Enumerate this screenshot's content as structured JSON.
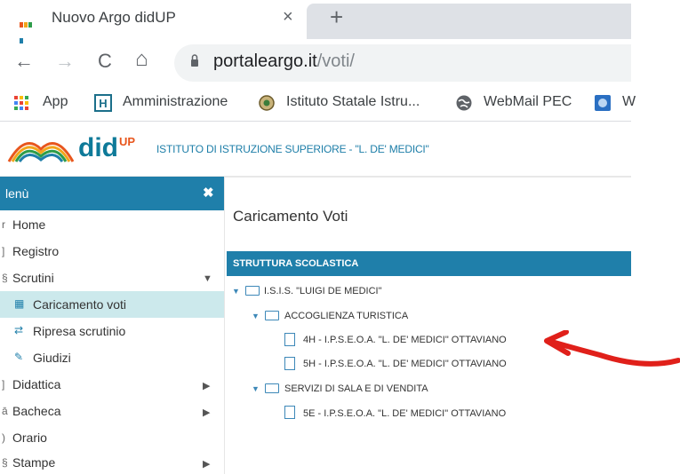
{
  "browser": {
    "tab_title": "Nuovo Argo didUP",
    "tab_close": "×",
    "new_tab": "+",
    "back": "←",
    "forward": "→",
    "reload": "C",
    "home": "⌂",
    "url_host": "portaleargo.it",
    "url_path": "/voti/",
    "bookmarks": [
      "App",
      "Amministrazione",
      "Istituto Statale Istru...",
      "WebMail PEC",
      "W"
    ]
  },
  "app": {
    "logo_text": "did",
    "logo_sup": "UP",
    "school_name": "ISTITUTO DI ISTRUZIONE SUPERIORE - \"L. DE' MEDICI\""
  },
  "sidebar": {
    "title": "lenù",
    "close": "✖",
    "items": [
      {
        "label": "Home",
        "icon": "home-icon",
        "glyph": "r"
      },
      {
        "label": "Registro",
        "icon": "register-icon",
        "glyph": "]"
      },
      {
        "label": "Scrutini",
        "icon": "scrutini-icon",
        "glyph": "§",
        "caret": "▼"
      },
      {
        "label": "Caricamento voti",
        "icon": "grid-icon",
        "glyph": "▦",
        "active": true
      },
      {
        "label": "Ripresa scrutinio",
        "icon": "refresh-icon",
        "glyph": "⇄"
      },
      {
        "label": "Giudizi",
        "icon": "edit-icon",
        "glyph": "✎"
      },
      {
        "label": "Didattica",
        "icon": "didattica-icon",
        "glyph": "]",
        "caret": "▶"
      },
      {
        "label": "Bacheca",
        "icon": "bacheca-icon",
        "glyph": "ā",
        "caret": "▶"
      },
      {
        "label": "Orario",
        "icon": "orario-icon",
        "glyph": ")"
      },
      {
        "label": "Stampe",
        "icon": "stampe-icon",
        "glyph": "§",
        "caret": "▶"
      }
    ]
  },
  "main": {
    "page_title": "Caricamento Voti",
    "panel_title": "STRUTTURA SCOLASTICA",
    "tree": {
      "root": "I.S.I.S. \"LUIGI DE MEDICI\"",
      "group1": "ACCOGLIENZA TURISTICA",
      "class1": "4H - I.P.S.E.O.A. \"L. DE' MEDICI\" OTTAVIANO",
      "class2": "5H - I.P.S.E.O.A. \"L. DE' MEDICI\" OTTAVIANO",
      "group2": "SERVIZI DI SALA E DI VENDITA",
      "class3": "5E - I.P.S.E.O.A. \"L. DE' MEDICI\" OTTAVIANO"
    }
  },
  "colors": {
    "accent": "#1f7faa",
    "active_item": "#cce9ec",
    "annotation": "#e0201a"
  }
}
